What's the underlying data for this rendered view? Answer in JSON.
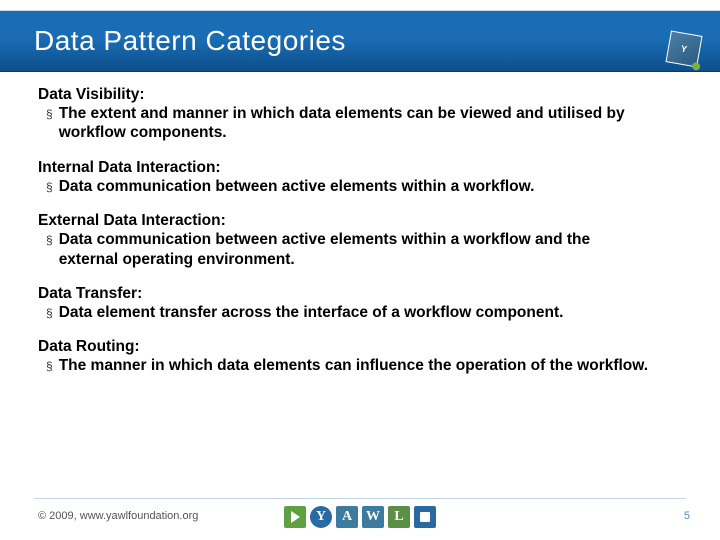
{
  "title": "Data Pattern Categories",
  "corner_logo_text": "Y",
  "sections": [
    {
      "heading": "Data Visibility:",
      "bullet": "The extent and manner in which data elements can be viewed and utilised by workflow components."
    },
    {
      "heading": "Internal Data Interaction:",
      "bullet": "Data communication between active elements within a workflow."
    },
    {
      "heading": "External Data Interaction:",
      "bullet": "Data communication between active elements within a workflow and the external operating environment."
    },
    {
      "heading": "Data Transfer:",
      "bullet": "Data element transfer across the interface of a workflow component."
    },
    {
      "heading": "Data Routing:",
      "bullet": "The manner in which data elements can influence the operation of the workflow."
    }
  ],
  "footer": {
    "copyright": "© 2009, www.yawlfoundation.org",
    "slide_number": "5",
    "logo_letters": [
      "",
      "Y",
      "A",
      "W",
      "L",
      ""
    ]
  }
}
